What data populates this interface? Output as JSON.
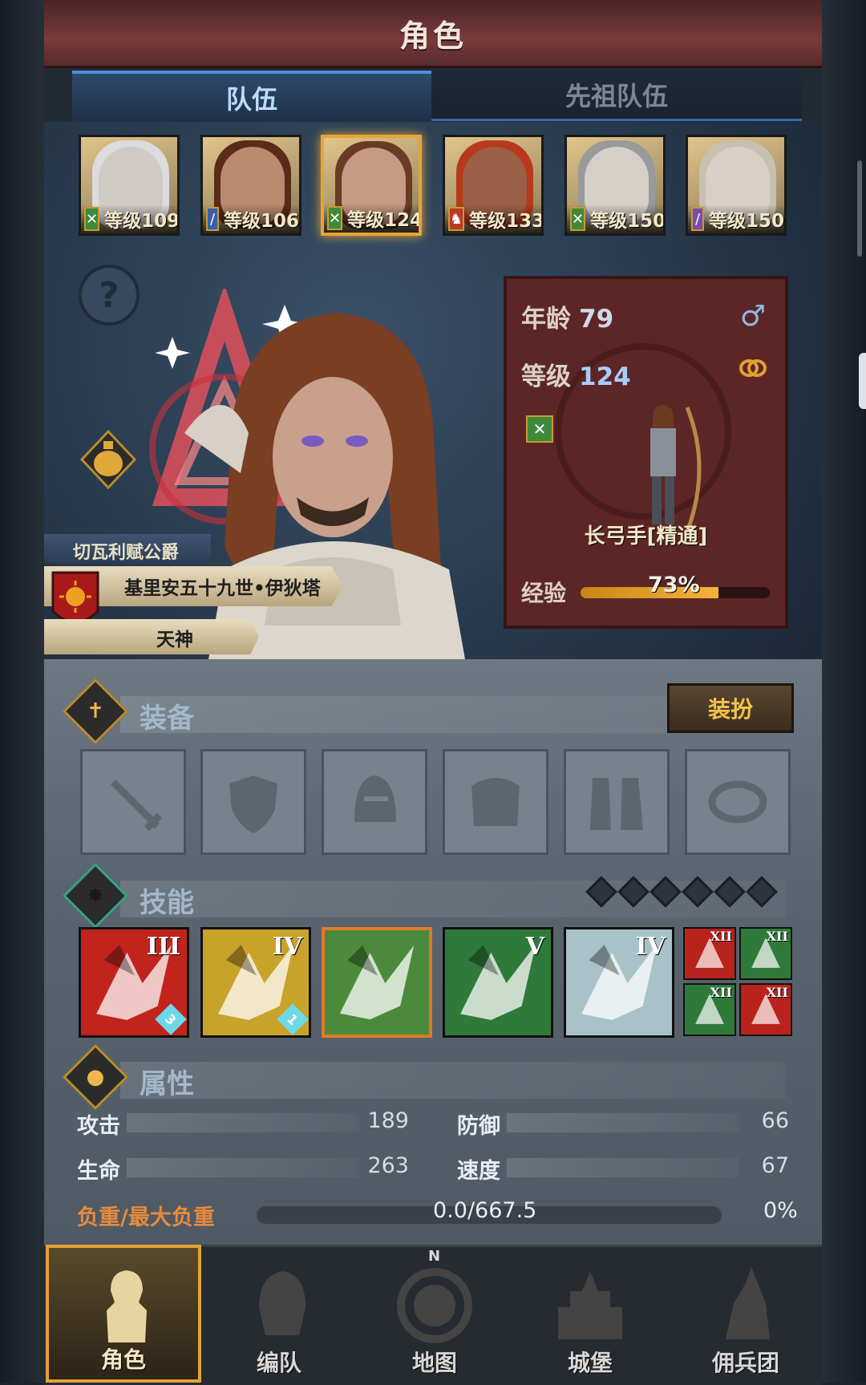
{
  "header": {
    "title": "角色"
  },
  "tabs": [
    {
      "label": "队伍",
      "active": true
    },
    {
      "label": "先祖队伍",
      "active": false
    }
  ],
  "team": [
    {
      "level_text": "等级109",
      "class_icon": "crossed-swords-icon",
      "color": "#3f8a3a",
      "skin": "#cfcac4",
      "hair": "#dcdcdc"
    },
    {
      "level_text": "等级106",
      "class_icon": "sword-icon",
      "color": "#3a5ea8",
      "skin": "#b98a6e",
      "hair": "#5a2a1a"
    },
    {
      "level_text": "等级124",
      "class_icon": "crossed-swords-icon",
      "color": "#3f8a3a",
      "skin": "#c79a84",
      "hair": "#6a3a24",
      "selected": true
    },
    {
      "level_text": "等级133",
      "class_icon": "beast-icon",
      "color": "#b83a2a",
      "skin": "#9a6046",
      "hair": "#b83a1a"
    },
    {
      "level_text": "等级150",
      "class_icon": "crossed-swords-icon",
      "color": "#3f8a3a",
      "skin": "#d6cfc8",
      "hair": "#9a9a9a"
    },
    {
      "level_text": "等级150",
      "class_icon": "staff-icon",
      "color": "#7a4ab0",
      "skin": "#d8d0c8",
      "hair": "#c8c0b0"
    }
  ],
  "hero": {
    "nobility": "切瓦利赋公爵",
    "name": "基里安五十九世•伊狄塔",
    "deity": "天神"
  },
  "info": {
    "age_label": "年龄",
    "age": "79",
    "level_label": "等级",
    "level": "124",
    "gender_icon": "♂",
    "class_name": "长弓手[精通]",
    "exp_label": "经验",
    "exp_percent_text": "73%",
    "exp_fraction": 0.73
  },
  "sections": {
    "equipment": "装备",
    "skills": "技能",
    "attributes": "属性",
    "dress_button": "装扮"
  },
  "equipment_slots": [
    "weapon-slot-icon",
    "shield-slot-icon",
    "helmet-slot-icon",
    "armor-slot-icon",
    "boots-slot-icon",
    "ring-slot-icon"
  ],
  "skills": [
    {
      "rank": "III",
      "bg": "#c0241c",
      "badge": "3"
    },
    {
      "rank": "IV",
      "bg": "#c9a22a",
      "badge": "1"
    },
    {
      "rank": "",
      "bg": "#4a8a3a",
      "selected": true
    },
    {
      "rank": "V",
      "bg": "#2f7a3a"
    },
    {
      "rank": "IV",
      "bg": "#a9c2c8"
    }
  ],
  "mini_skills": [
    {
      "rank": "XII",
      "bg": "#b8231c"
    },
    {
      "rank": "XII",
      "bg": "#2f7a3a"
    },
    {
      "rank": "XII",
      "bg": "#2f7a3a"
    },
    {
      "rank": "XII",
      "bg": "#b8231c"
    }
  ],
  "stats": {
    "attack_label": "攻击",
    "attack": "189",
    "defense_label": "防御",
    "defense": "66",
    "hp_label": "生命",
    "hp": "263",
    "speed_label": "速度",
    "speed": "67",
    "load_label": "负重/最大负重",
    "load": "0.0/667.5",
    "load_pct": "0%"
  },
  "nav": [
    {
      "label": "角色",
      "active": true
    },
    {
      "label": "编队",
      "active": false
    },
    {
      "label": "地图",
      "active": false
    },
    {
      "label": "城堡",
      "active": false
    },
    {
      "label": "佣兵团",
      "active": false
    }
  ],
  "compass_letter": "N"
}
